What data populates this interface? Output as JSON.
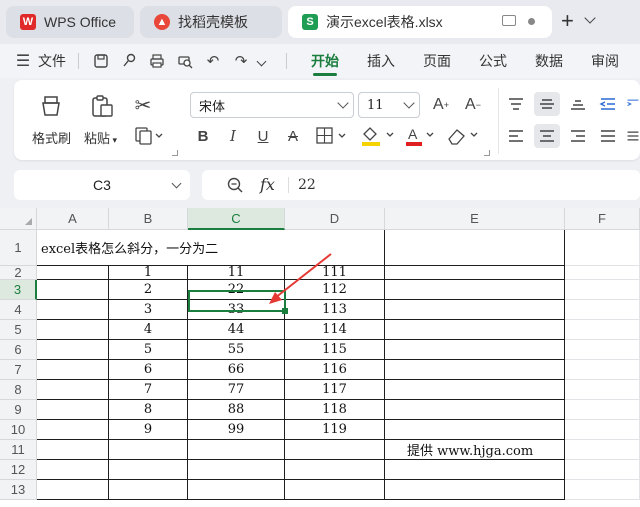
{
  "tabs": [
    {
      "label": "WPS Office",
      "icon": "wps-logo-icon"
    },
    {
      "label": "找稻壳模板",
      "icon": "docer-icon"
    },
    {
      "label": "演示excel表格.xlsx",
      "icon": "spreadsheet-icon"
    }
  ],
  "menu": {
    "file_label": "文件",
    "items": [
      "开始",
      "插入",
      "页面",
      "公式",
      "数据",
      "审阅"
    ],
    "active": "开始"
  },
  "ribbon": {
    "format_painter": "格式刷",
    "paste": "粘贴",
    "font_name": "宋体",
    "font_size": "11"
  },
  "formula_bar": {
    "cell_ref": "C3",
    "fx": "fx",
    "value": "22"
  },
  "grid": {
    "columns": [
      "A",
      "B",
      "C",
      "D",
      "E",
      "F"
    ],
    "rows": [
      "1",
      "2",
      "3",
      "4",
      "5",
      "6",
      "7",
      "8",
      "9",
      "10",
      "11",
      "12",
      "13"
    ],
    "title": "excel表格怎么斜分，一分为二",
    "col_b": [
      "1",
      "2",
      "3",
      "4",
      "5",
      "6",
      "7",
      "8",
      "9"
    ],
    "col_c": [
      "11",
      "22",
      "33",
      "44",
      "55",
      "66",
      "77",
      "88",
      "99"
    ],
    "col_d": [
      "111",
      "112",
      "113",
      "114",
      "115",
      "116",
      "117",
      "118",
      "119"
    ],
    "credit": "提供 www.hjga.com"
  },
  "colors": {
    "accent": "#1b7e3e",
    "arrow": "#e53935"
  }
}
